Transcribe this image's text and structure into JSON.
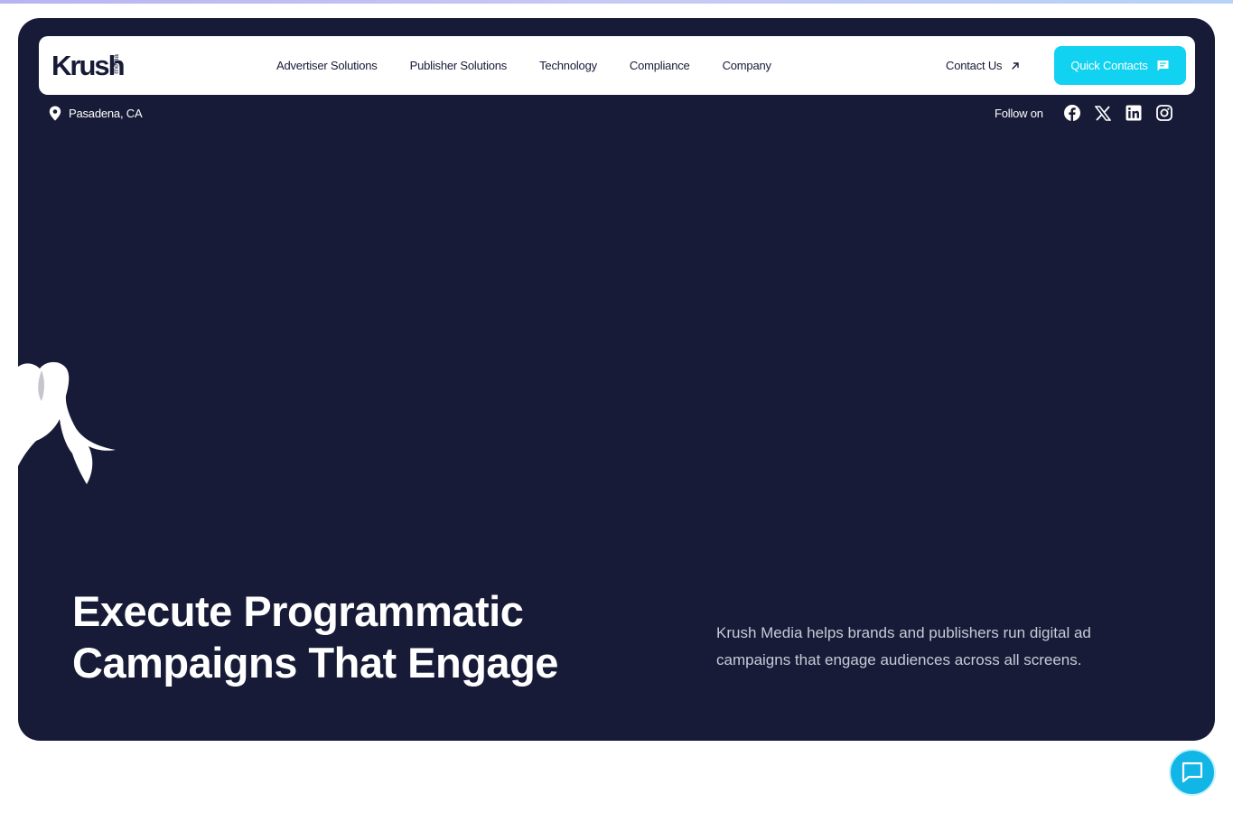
{
  "brand": {
    "logo_word": "Krush",
    "logo_sub": "media",
    "accent_color": "#11d2f0",
    "hero_bg_color": "#181b37"
  },
  "nav": {
    "links": [
      "Advertiser Solutions",
      "Publisher Solutions",
      "Technology",
      "Compliance",
      "Company"
    ],
    "contact_label": "Contact Us",
    "contact_icon": "arrow-up-right-icon",
    "quick_contacts_label": "Quick Contacts",
    "quick_contacts_icon": "message-icon"
  },
  "info_bar": {
    "location_icon": "map-pin-icon",
    "location": "Pasadena, CA",
    "follow_label": "Follow on",
    "social_icons": [
      "facebook-icon",
      "x-icon",
      "linkedin-icon",
      "instagram-icon"
    ]
  },
  "hero": {
    "headline_line1": "Execute Programmatic",
    "headline_line2": "Campaigns That Engage",
    "subtext": "Krush Media helps brands and publishers run digital ad campaigns that engage audiences across all screens."
  },
  "chat": {
    "icon": "chat-bubble-icon"
  }
}
